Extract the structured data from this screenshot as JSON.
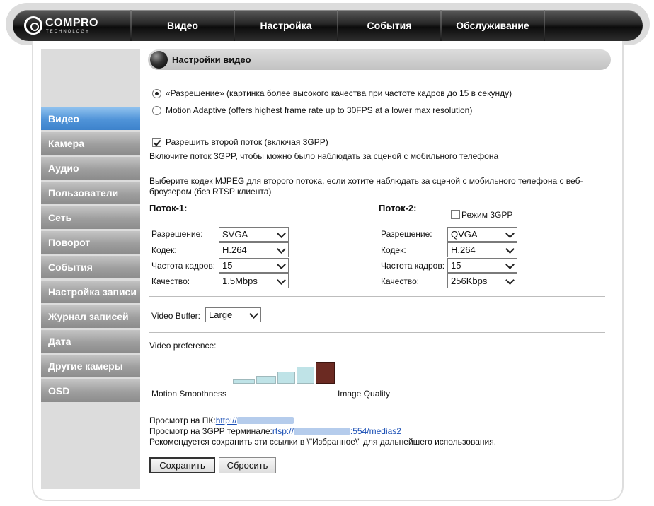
{
  "header": {
    "logo_text": "COMPRO",
    "logo_sub": "TECHNOLOGY",
    "nav": [
      {
        "label": "Видео"
      },
      {
        "label": "Настройка"
      },
      {
        "label": "События"
      },
      {
        "label": "Обслуживание"
      }
    ]
  },
  "sidebar": {
    "items": [
      {
        "label": "Видео",
        "active": true
      },
      {
        "label": "Камера"
      },
      {
        "label": "Аудио"
      },
      {
        "label": "Пользователи"
      },
      {
        "label": "Сеть"
      },
      {
        "label": "Поворот"
      },
      {
        "label": "События"
      },
      {
        "label": "Настройка записи"
      },
      {
        "label": "Журнал записей"
      },
      {
        "label": "Дата"
      },
      {
        "label": "Другие камеры"
      },
      {
        "label": "OSD"
      }
    ]
  },
  "main": {
    "title": "Настройки видео",
    "mode": {
      "selected": "resolution",
      "resolution_label": "«Разрешение» (картинка более высокого качества при частоте кадров до 15 в секунду)",
      "motion_label": "Motion Adaptive (offers highest frame rate up to 30FPS at a lower max resolution)"
    },
    "second_stream": {
      "checked": true,
      "label": "Разрешить второй поток (включая 3GPP)",
      "note": "Включите поток 3GPP, чтобы можно было наблюдать за сценой с мобильного телефона"
    },
    "mjpeg_note_line1": "Выберите кодек MJPEG для второго потока, если хотите наблюдать за сценой с мобильного телефона с веб-",
    "mjpeg_note_line2": "броузером (без RTSP клиента)",
    "stream1": {
      "heading": "Поток-1:",
      "resolution_label": "Разрешение:",
      "resolution_value": "SVGA",
      "codec_label": "Кодек:",
      "codec_value": "H.264",
      "fps_label": "Частота кадров:",
      "fps_value": "15",
      "quality_label": "Качество:",
      "quality_value": "1.5Mbps"
    },
    "stream2": {
      "heading": "Поток-2:",
      "mode_3gpp_label": "Режим 3GPP",
      "mode_3gpp_checked": false,
      "resolution_label": "Разрешение:",
      "resolution_value": "QVGA",
      "codec_label": "Кодек:",
      "codec_value": "H.264",
      "fps_label": "Частота кадров:",
      "fps_value": "15",
      "quality_label": "Качество:",
      "quality_value": "256Kbps"
    },
    "video_buffer": {
      "label": "Video Buffer:",
      "value": "Large"
    },
    "preference": {
      "label": "Video preference:",
      "left_label": "Motion Smoothness",
      "right_label": "Image Quality",
      "levels": 5,
      "selected_level": 5
    },
    "links": {
      "pc_label": "Просмотр на ПК:",
      "pc_link_prefix": "http://",
      "gpp_label": "Просмотр на 3GPP терминале:",
      "gpp_link_prefix": "rtsp://",
      "gpp_link_suffix": ":554/medias2",
      "note": "Рекомендуется сохранить эти ссылки в \\\"Избранное\\\" для дальнейшего использования."
    },
    "buttons": {
      "save": "Сохранить",
      "reset": "Сбросить"
    }
  }
}
